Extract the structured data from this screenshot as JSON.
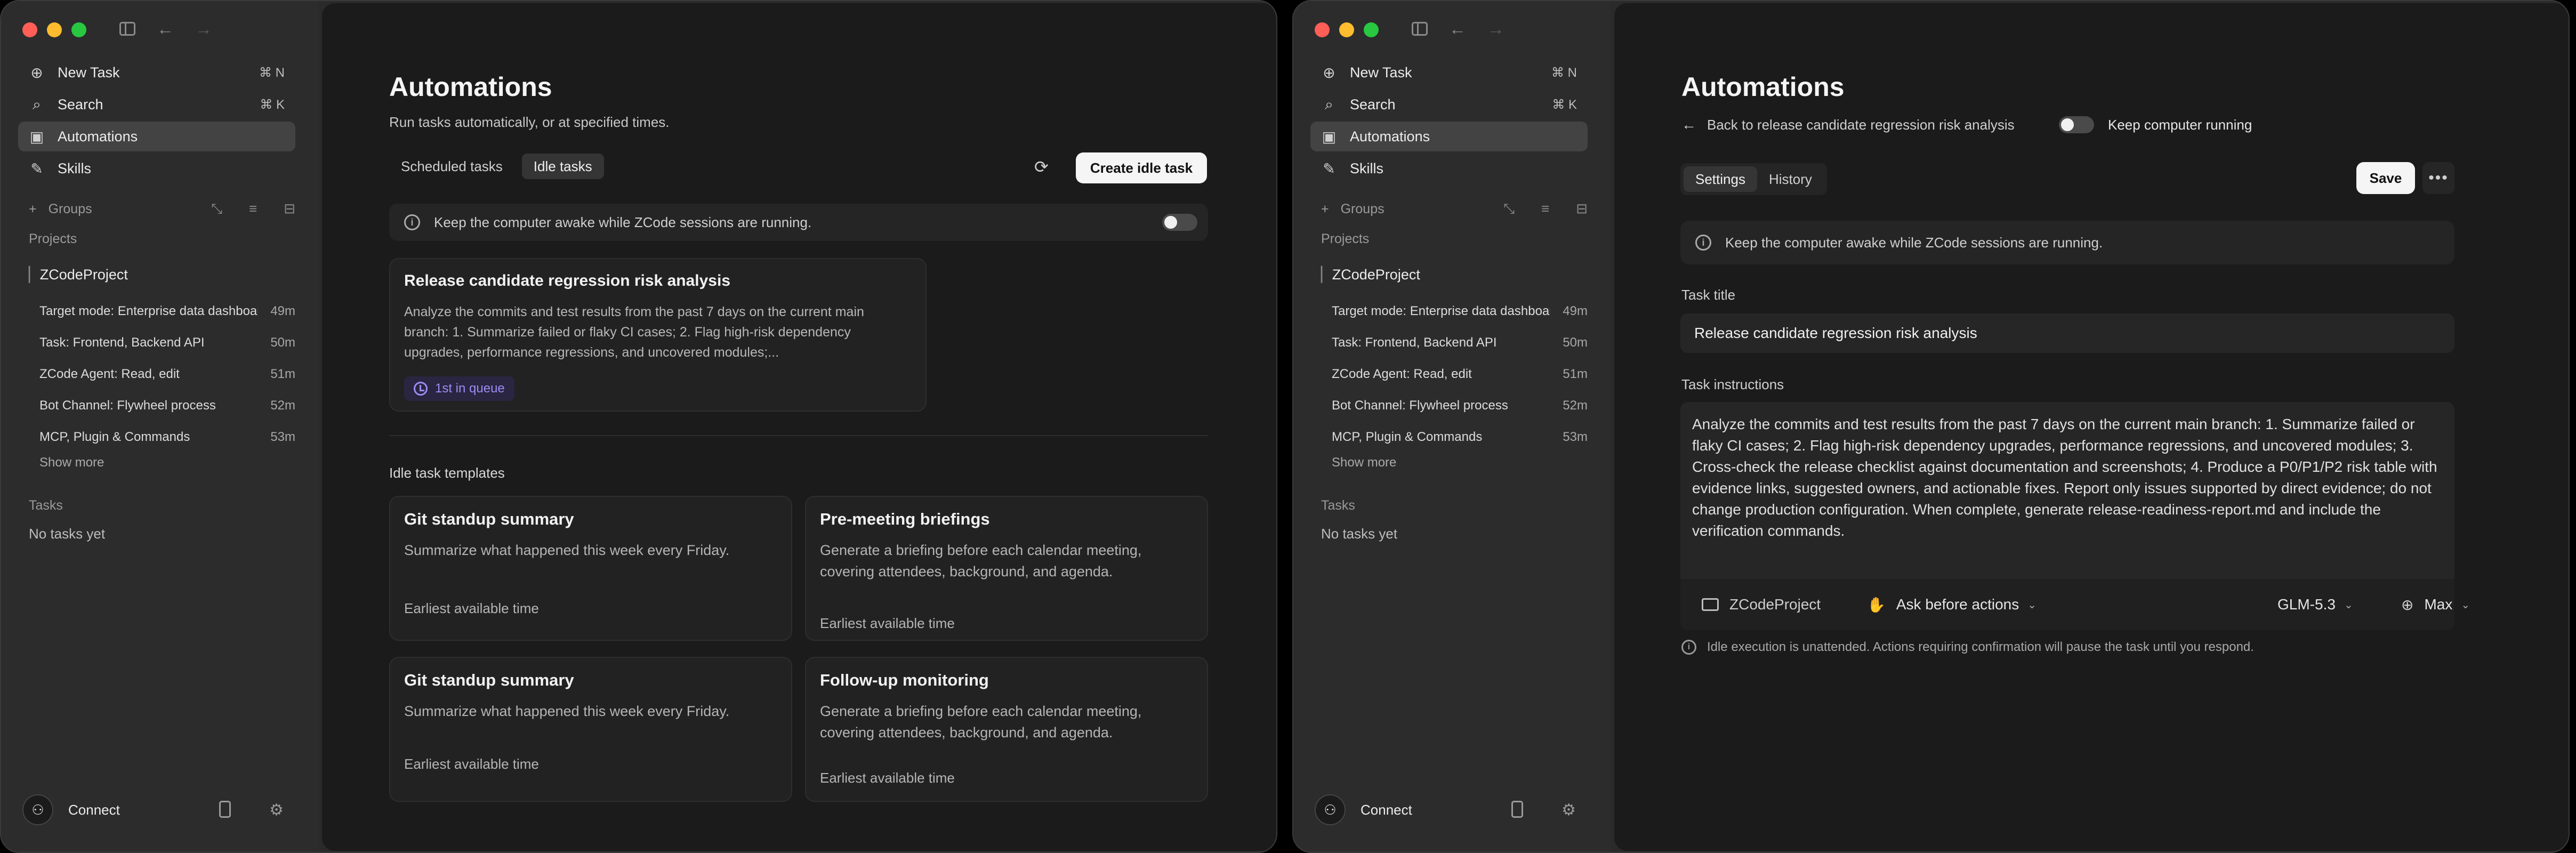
{
  "sidebar": {
    "nav": [
      {
        "label": "New Task",
        "shortcut": "⌘ N",
        "icon": "new-task-icon"
      },
      {
        "label": "Search",
        "shortcut": "⌘ K",
        "icon": "search-icon"
      },
      {
        "label": "Automations",
        "shortcut": "",
        "icon": "automations-icon"
      },
      {
        "label": "Skills",
        "shortcut": "",
        "icon": "skills-icon"
      }
    ],
    "groups_label": "Groups",
    "projects_label": "Projects",
    "project_name": "ZCodeProject",
    "project_items": [
      {
        "label": "Target mode:  Enterprise data dashboard",
        "time": "49m"
      },
      {
        "label": "Task:  Frontend, Backend API",
        "time": "50m"
      },
      {
        "label": "ZCode Agent:  Read, edit",
        "time": "51m"
      },
      {
        "label": "Bot Channel:  Flywheel process",
        "time": "52m"
      },
      {
        "label": "MCP, Plugin & Commands",
        "time": "53m"
      }
    ],
    "show_more": "Show more",
    "tasks_label": "Tasks",
    "no_tasks": "No tasks yet",
    "connect_label": "Connect"
  },
  "left": {
    "title": "Automations",
    "subtitle": "Run tasks automatically, or at specified times.",
    "tabs": [
      "Scheduled tasks",
      "Idle tasks"
    ],
    "create_button": "Create idle task",
    "awake_text": "Keep the computer awake while ZCode sessions are running.",
    "task_card": {
      "title": "Release candidate regression risk analysis",
      "desc": "Analyze the commits and test results from the past 7 days on the current main branch: 1. Summarize failed or flaky CI cases; 2. Flag high-risk dependency upgrades, performance regressions, and uncovered modules;...",
      "badge": "1st in queue"
    },
    "templates_heading": "Idle task templates",
    "templates": [
      {
        "title": "Git standup summary",
        "desc": "Summarize what happened this week every Friday.",
        "time": "Earliest available time"
      },
      {
        "title": "Pre-meeting briefings",
        "desc": "Generate a briefing before each calendar meeting, covering attendees, background, and agenda.",
        "time": "Earliest available time"
      },
      {
        "title": "Git standup summary",
        "desc": "Summarize what happened this week every Friday.",
        "time": "Earliest available time"
      },
      {
        "title": "Follow-up monitoring",
        "desc": "Generate a briefing before each calendar meeting, covering attendees, background, and agenda.",
        "time": "Earliest available time"
      }
    ]
  },
  "right": {
    "title": "Automations",
    "back_link": "Back to release candidate regression risk analysis",
    "keep_running": "Keep computer running",
    "tabs": [
      "Settings",
      "History"
    ],
    "save_button": "Save",
    "more_button": "•••",
    "awake_text": "Keep the computer awake while ZCode sessions are running.",
    "task_title_label": "Task title",
    "task_title_value": "Release candidate regression risk analysis",
    "instructions_label": "Task instructions",
    "instructions": "Analyze the commits and test results from the past 7 days on the current main branch: 1. Summarize failed or flaky CI cases; 2. Flag high-risk dependency upgrades, performance regressions, and uncovered modules; 3. Cross-check the release checklist against documentation and screenshots; 4. Produce a P0/P1/P2 risk table with evidence links, suggested owners, and actionable fixes. Report only issues supported by direct evidence; do not change production configuration. When complete, generate release-readiness-report.md and include the verification commands.",
    "project": "ZCodeProject",
    "permission": "Ask before actions",
    "model": "GLM-5.3",
    "effort": "Max",
    "note": "Idle execution is unattended. Actions requiring confirmation will pause the task until you respond."
  }
}
